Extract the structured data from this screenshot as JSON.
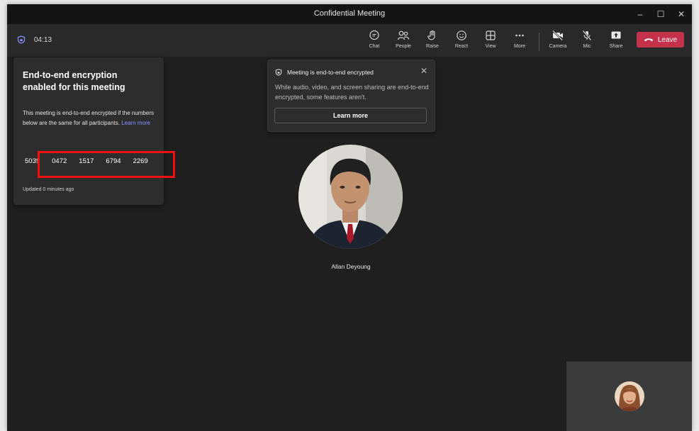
{
  "window": {
    "title": "Confidential Meeting",
    "controls": [
      "–",
      "☐",
      "✕"
    ]
  },
  "toolbar": {
    "timer": "04:13",
    "buttons": {
      "chat": "Chat",
      "people": "People",
      "raise": "Raise",
      "react": "React",
      "view": "View",
      "more": "More",
      "camera": "Camera",
      "mic": "Mic",
      "share": "Share"
    },
    "leave": "Leave"
  },
  "encryption_panel": {
    "title": "End-to-end encryption enabled for this meeting",
    "description": "This meeting is end-to-end encrypted if the numbers below are the same for all participants.",
    "learn_more": "Learn more",
    "codes": [
      "5039",
      "0472",
      "1517",
      "6794",
      "2269"
    ],
    "updated": "Updated 0 minutes ago"
  },
  "notice": {
    "title": "Meeting is end-to-end encrypted",
    "body": "While audio, video, and screen sharing are end-to-end encrypted, some features aren't.",
    "button": "Learn more",
    "close": "✕"
  },
  "participant": {
    "name": "Allan Deyoung"
  },
  "colors": {
    "leave_button": "#c4314b",
    "link": "#8f93ff",
    "highlight_box": "#ee1111",
    "background": "#1f1f1f"
  }
}
